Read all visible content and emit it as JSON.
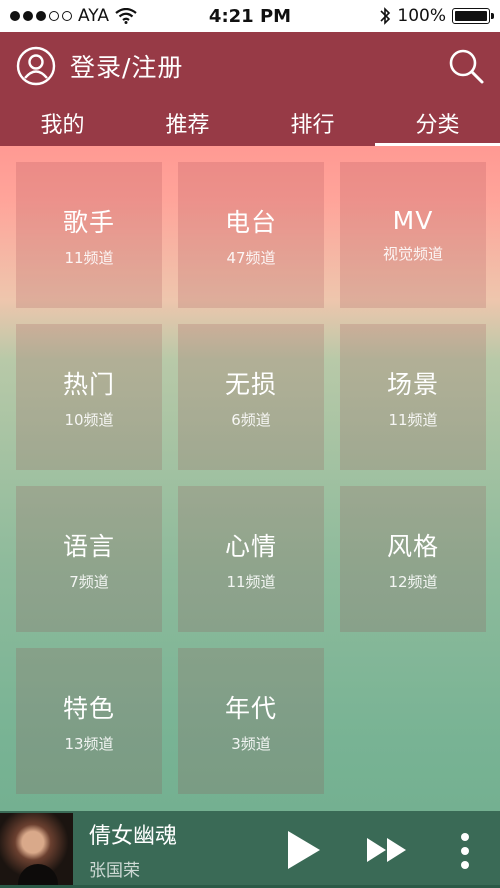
{
  "status_bar": {
    "carrier": "AYA",
    "time": "4:21 PM",
    "battery_text": "100%",
    "battery_level": 1.0,
    "signal_dots_filled": 3,
    "signal_dots_total": 5
  },
  "header": {
    "login_label": "登录/注册",
    "avatar_icon": "user-circle-icon",
    "search_icon": "search-icon",
    "color": "#973a46"
  },
  "tabs": [
    {
      "label": "我的",
      "active": false
    },
    {
      "label": "推荐",
      "active": false
    },
    {
      "label": "排行",
      "active": false
    },
    {
      "label": "分类",
      "active": true
    }
  ],
  "categories": [
    {
      "title": "歌手",
      "subtitle": "11频道"
    },
    {
      "title": "电台",
      "subtitle": "47频道"
    },
    {
      "title": "MV",
      "subtitle": "视觉频道"
    },
    {
      "title": "热门",
      "subtitle": "10频道"
    },
    {
      "title": "无损",
      "subtitle": "6频道"
    },
    {
      "title": "场景",
      "subtitle": "11频道"
    },
    {
      "title": "语言",
      "subtitle": "7频道"
    },
    {
      "title": "心情",
      "subtitle": "11频道"
    },
    {
      "title": "风格",
      "subtitle": "12频道"
    },
    {
      "title": "特色",
      "subtitle": "13频道"
    },
    {
      "title": "年代",
      "subtitle": "3频道"
    }
  ],
  "player": {
    "track_title": "倩女幽魂",
    "artist": "张国荣",
    "progress": 0.0,
    "color": "#3a6a56",
    "icons": [
      "play-icon",
      "next-icon",
      "more-vertical-icon"
    ]
  }
}
